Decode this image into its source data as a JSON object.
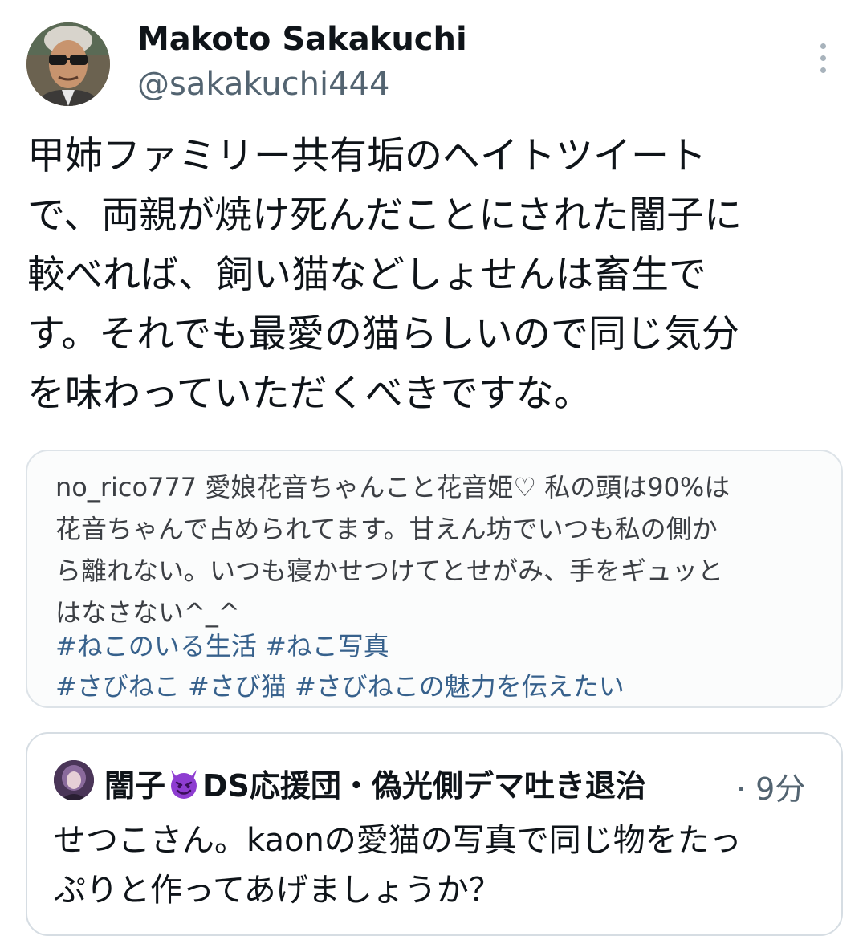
{
  "tweet": {
    "author": {
      "display_name": "Makoto Sakakuchi",
      "handle": "@sakakuchi444",
      "avatar_icon": "user-avatar-photo"
    },
    "more_icon": "more-vertical-icon",
    "text_lines": [
      "甲姉ファミリー共有垢のヘイトツイート",
      "で、両親が焼け死んだことにされた闇子に",
      "較べれば、飼い猫などしょせんは畜生で",
      "す。それでも最愛の猫らしいので同じ気分",
      "を味わっていただくべきですな。"
    ]
  },
  "media": {
    "caption_lines": [
      "no_rico777 愛娘花音ちゃんこと花音姫♡ 私の頭は90%は",
      "花音ちゃんで占められてます。甘えん坊でいつも私の側か",
      "ら離れない。いつも寝かせつけてとせがみ、手をギュッと",
      "はなさない^_^"
    ],
    "hashtag_lines": [
      "#ねこのいる生活 #ねこ写真",
      "#さびねこ #さび猫 #さびねこの魅力を伝えたい"
    ]
  },
  "quote": {
    "name_part1": "闇子",
    "emoji_icon": "smiling-devil-emoji-icon",
    "name_part2": "DS応援団・偽光側デマ吐き退治",
    "time": "· 9分",
    "text_lines": [
      "せつこさん。kaonの愛猫の写真で同じ物をたっ",
      "ぷりと作ってあげましょうか？"
    ]
  },
  "colors": {
    "text_primary": "#0f1419",
    "text_secondary": "#536471",
    "hashtag": "#37618c",
    "border": "#dde3e8",
    "devil_purple": "#8e3dd1"
  }
}
